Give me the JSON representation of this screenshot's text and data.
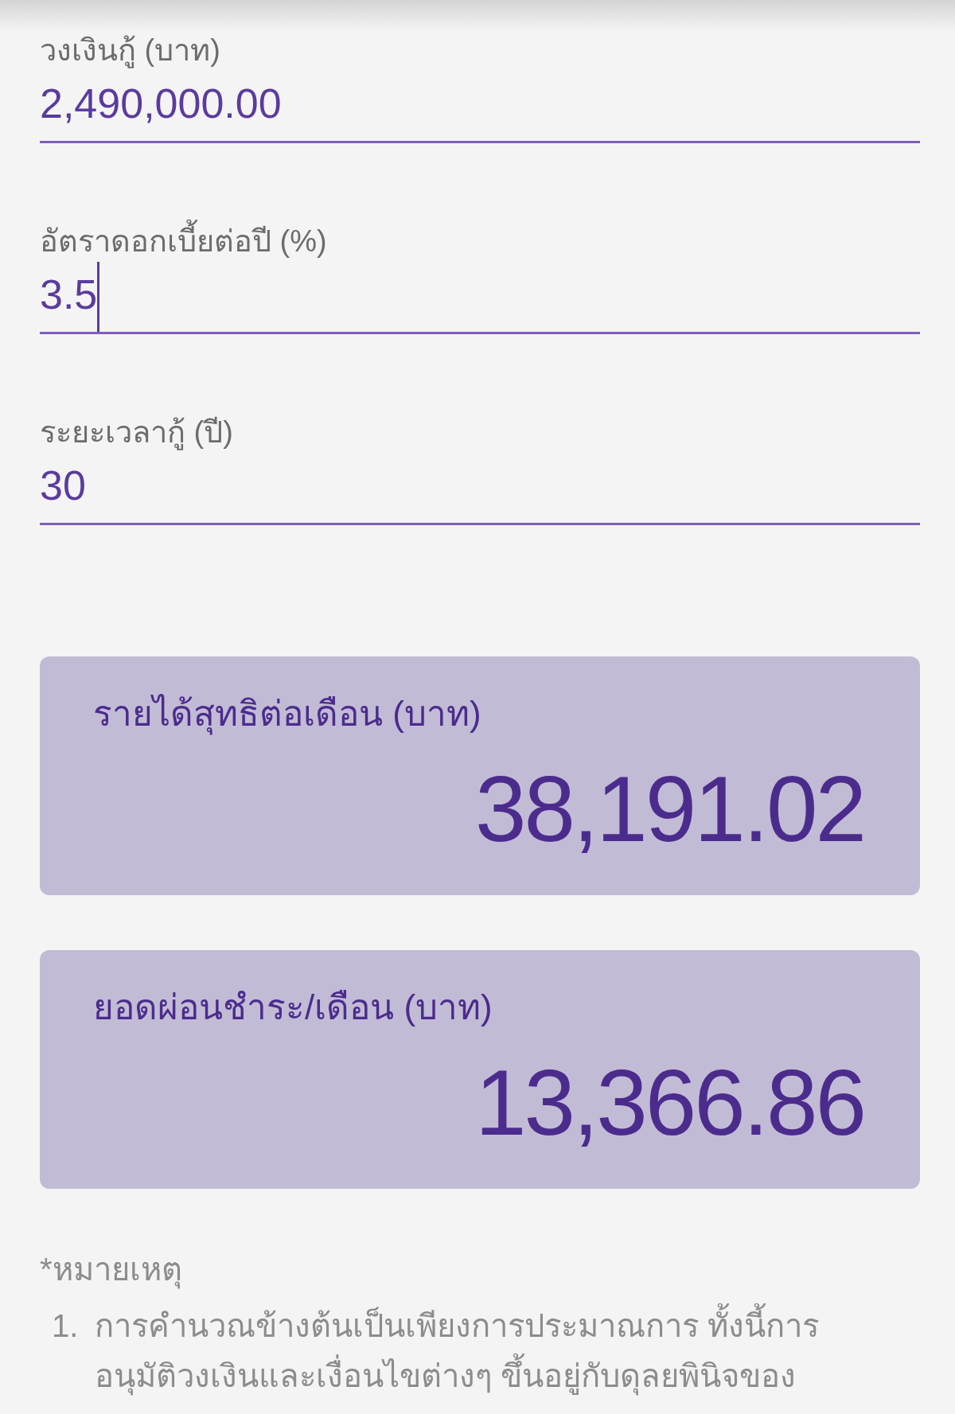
{
  "fields": [
    {
      "label": "วงเงินกู้ (บาท)",
      "value": "2,490,000.00",
      "focused": false
    },
    {
      "label": "อัตราดอกเบี้ยต่อปี (%)",
      "value": "3.5",
      "focused": true
    },
    {
      "label": "ระยะเวลากู้ (ปี)",
      "value": "30",
      "focused": false
    }
  ],
  "results": [
    {
      "label": "รายได้สุทธิต่อเดือน (บาท)",
      "value": "38,191.02"
    },
    {
      "label": "ยอดผ่อนชำระ/เดือน (บาท)",
      "value": "13,366.86"
    }
  ],
  "notes": {
    "title": "*หมายเหตุ",
    "items": [
      {
        "number": "1.",
        "text": "การคำนวณข้างต้นเป็นเพียงการประมาณการ ทั้งนี้การอนุมัติวงเงินและเงื่อนไขต่างๆ ขึ้นอยู่กับดุลยพินิจของ"
      }
    ]
  }
}
